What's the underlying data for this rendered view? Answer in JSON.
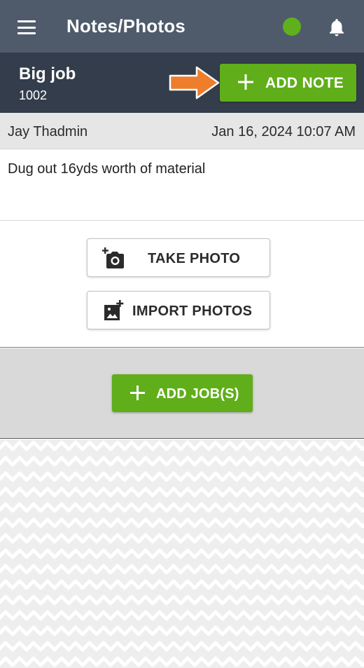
{
  "app_bar": {
    "title": "Notes/Photos",
    "status_color": "#5fb01c",
    "icons": [
      "menu-icon",
      "bell-icon"
    ]
  },
  "job": {
    "title": "Big job",
    "number": "1002",
    "add_note_label": "ADD NOTE",
    "add_note_icon": "plus-icon",
    "pointer_icon": "arrow-right-icon"
  },
  "note": {
    "author": "Jay Thadmin",
    "date": "Jan 16, 2024 10:07 AM",
    "text": "Dug out 16yds worth of material"
  },
  "photos": {
    "take_photo_label": "TAKE PHOTO",
    "take_photo_icon": "add-camera-icon",
    "import_photos_label": "IMPORT PHOTOS",
    "import_photos_icon": "add-image-icon"
  },
  "jobs": {
    "add_jobs_label": "ADD JOB(S)",
    "add_jobs_icon": "plus-icon"
  },
  "colors": {
    "header": "#4f5b6b",
    "job_bar": "#333d4b",
    "accent_green": "#5fae1a",
    "arrow_orange": "#ee7d2c"
  }
}
